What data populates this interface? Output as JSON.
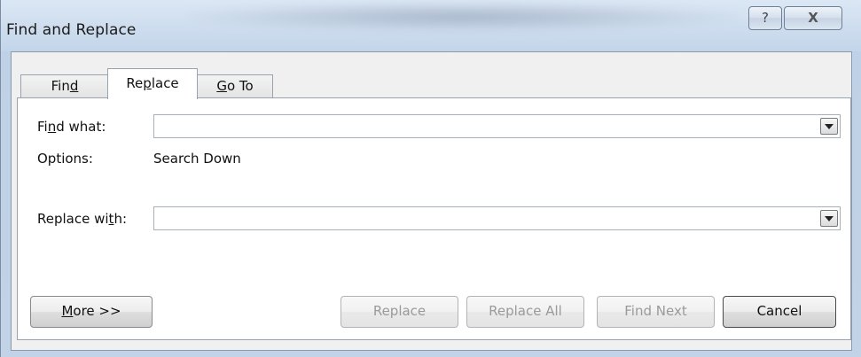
{
  "window": {
    "title": "Find and Replace",
    "help_glyph": "?",
    "close_glyph": "X"
  },
  "tabs": [
    {
      "prefix": "Fin",
      "access_key": "d",
      "suffix": "",
      "active": false
    },
    {
      "prefix": "Re",
      "access_key": "p",
      "suffix": "lace",
      "active": true
    },
    {
      "prefix": "",
      "access_key": "G",
      "suffix": "o To",
      "active": false
    }
  ],
  "find": {
    "label_prefix": "Fi",
    "label_key": "n",
    "label_suffix": "d what:",
    "value": ""
  },
  "options": {
    "label": "Options:",
    "value": "Search Down"
  },
  "replace": {
    "label_prefix": "Replace wi",
    "label_key": "t",
    "label_suffix": "h:",
    "value": ""
  },
  "buttons": {
    "more_key": "M",
    "more_suffix": "ore >>",
    "replace": "Replace",
    "replace_all": "Replace All",
    "find_next": "Find Next",
    "cancel": "Cancel"
  },
  "colors": {
    "window_frame": "#c2d3e7",
    "disabled_text": "#9a9a9a"
  }
}
